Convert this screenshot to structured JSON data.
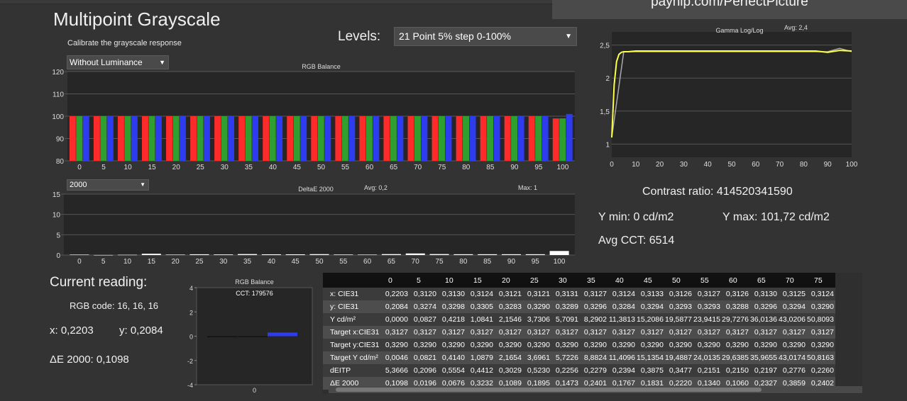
{
  "banner": "payhip.com/PerfectPicture",
  "title": "Multipoint Grayscale",
  "subtitle": "Calibrate the grayscale response",
  "luminance_mode": "Without Luminance",
  "levels": {
    "label": "Levels:",
    "value": "21 Point 5% step 0-100%"
  },
  "rgb_balance_chart": {
    "title": "RGB Balance",
    "type": "bar",
    "yticks": [
      "80",
      "90",
      "100",
      "110",
      "120"
    ],
    "ylim": [
      80,
      120
    ],
    "categories": [
      "0",
      "5",
      "10",
      "15",
      "20",
      "25",
      "30",
      "35",
      "40",
      "45",
      "50",
      "55",
      "60",
      "65",
      "70",
      "75",
      "80",
      "85",
      "90",
      "95",
      "100"
    ],
    "series": [
      {
        "color": "#ff2a2a",
        "values": [
          100,
          100,
          100,
          100,
          100,
          100,
          100,
          100,
          100,
          100,
          100,
          100,
          100,
          100,
          100,
          100,
          100,
          100,
          100,
          100,
          99
        ]
      },
      {
        "color": "#2fa02f",
        "values": [
          100,
          100,
          100,
          100,
          100,
          100,
          100,
          100,
          100,
          100,
          100,
          100,
          100,
          100,
          100,
          100,
          100,
          100,
          100,
          100,
          99
        ]
      },
      {
        "color": "#2e3cf0",
        "values": [
          100,
          100,
          100,
          100,
          100,
          100,
          100,
          100,
          100,
          100,
          100,
          100,
          100,
          100,
          100,
          100,
          100,
          100,
          100,
          100,
          101
        ]
      }
    ]
  },
  "deltae_chart": {
    "selector": "2000",
    "title": "DeltaE 2000",
    "avg_label": "Avg: 0,2",
    "max_label": "Max: 1",
    "type": "bar",
    "yticks": [
      "0",
      "5",
      "10",
      "15"
    ],
    "ylim": [
      0,
      15
    ],
    "categories": [
      "0",
      "5",
      "10",
      "15",
      "20",
      "25",
      "30",
      "35",
      "40",
      "45",
      "50",
      "55",
      "60",
      "65",
      "70",
      "75",
      "80",
      "85",
      "90",
      "95",
      "100"
    ],
    "values": [
      0.11,
      0.02,
      0.07,
      0.32,
      0.11,
      0.19,
      0.15,
      0.24,
      0.18,
      0.18,
      0.22,
      0.13,
      0.11,
      0.23,
      0.39,
      0.24,
      0.2,
      0.2,
      0.2,
      0.2,
      1.0
    ]
  },
  "gamma_chart": {
    "title": "Gamma Log/Log",
    "avg_label": "Avg: 2,4",
    "type": "line",
    "yticks": [
      "1",
      "1,5",
      "2",
      "2,5"
    ],
    "ylim": [
      0.8,
      2.7
    ],
    "xticks": [
      "0",
      "10",
      "20",
      "30",
      "40",
      "50",
      "60",
      "70",
      "80",
      "90",
      "100"
    ],
    "xlim": [
      0,
      100
    ],
    "series": [
      {
        "color": "#ffff44",
        "x": [
          0,
          1,
          2,
          3,
          4,
          5,
          7,
          10,
          15,
          20,
          30,
          40,
          50,
          60,
          70,
          80,
          85,
          90,
          95,
          100
        ],
        "y": [
          1.1,
          1.9,
          2.25,
          2.36,
          2.39,
          2.4,
          2.4,
          2.41,
          2.41,
          2.41,
          2.41,
          2.41,
          2.41,
          2.41,
          2.41,
          2.41,
          2.41,
          2.39,
          2.42,
          2.41
        ]
      },
      {
        "color": "#aaaaaa",
        "x": [
          0,
          5,
          10,
          20,
          30,
          40,
          50,
          60,
          70,
          80,
          90,
          95,
          100
        ],
        "y": [
          1.1,
          2.4,
          2.4,
          2.4,
          2.4,
          2.4,
          2.4,
          2.4,
          2.4,
          2.4,
          2.4,
          2.45,
          2.4
        ]
      }
    ]
  },
  "stats": {
    "contrast": "Contrast ratio: 414520341590",
    "ymin": "Y min: 0 cd/m2",
    "ymax": "Y max: 101,72 cd/m2",
    "avg_cct": "Avg CCT: 6514"
  },
  "current": {
    "heading": "Current reading:",
    "rgb_code": "RGB code: 16, 16, 16",
    "x": "x: 0,2203",
    "y": "y: 0,2084",
    "de": "ΔE 2000: 0,1098"
  },
  "mini_chart": {
    "title": "RGB Balance",
    "cct": "CCT: 179576",
    "type": "bar",
    "yticks": [
      "-4",
      "-2",
      "0",
      "2",
      "4"
    ],
    "ylim": [
      -4,
      4
    ],
    "xlabel": "0",
    "values": {
      "red": 0,
      "green": 0,
      "blue": 0.3
    }
  },
  "table": {
    "columns": [
      "0",
      "5",
      "10",
      "15",
      "20",
      "25",
      "30",
      "35",
      "40",
      "45",
      "50",
      "55",
      "60",
      "65",
      "70",
      "75"
    ],
    "rows": [
      {
        "label": "x: CIE31",
        "values": [
          "0,2203",
          "0,3120",
          "0,3130",
          "0,3124",
          "0,3121",
          "0,3121",
          "0,3131",
          "0,3127",
          "0,3124",
          "0,3133",
          "0,3126",
          "0,3127",
          "0,3126",
          "0,3130",
          "0,3125",
          "0,3124"
        ]
      },
      {
        "label": "y: CIE31",
        "values": [
          "0,2084",
          "0,3274",
          "0,3298",
          "0,3305",
          "0,3283",
          "0,3290",
          "0,3289",
          "0,3296",
          "0,3284",
          "0,3294",
          "0,3293",
          "0,3293",
          "0,3288",
          "0,3296",
          "0,3294",
          "0,3290"
        ]
      },
      {
        "label": "Y cd/m²",
        "values": [
          "0,0000",
          "0,0827",
          "0,4218",
          "1,0841",
          "2,1546",
          "3,7306",
          "5,7091",
          "8,2902",
          "11,3813",
          "15,2086",
          "19,5877",
          "23,9415",
          "29,7276",
          "36,0136",
          "43,0206",
          "50,8093"
        ]
      },
      {
        "label": "Target x:CIE31",
        "values": [
          "0,3127",
          "0,3127",
          "0,3127",
          "0,3127",
          "0,3127",
          "0,3127",
          "0,3127",
          "0,3127",
          "0,3127",
          "0,3127",
          "0,3127",
          "0,3127",
          "0,3127",
          "0,3127",
          "0,3127",
          "0,3127"
        ]
      },
      {
        "label": "Target y:CIE31",
        "values": [
          "0,3290",
          "0,3290",
          "0,3290",
          "0,3290",
          "0,3290",
          "0,3290",
          "0,3290",
          "0,3290",
          "0,3290",
          "0,3290",
          "0,3290",
          "0,3290",
          "0,3290",
          "0,3290",
          "0,3290",
          "0,3290"
        ]
      },
      {
        "label": "Target Y cd/m²",
        "values": [
          "0,0046",
          "0,0821",
          "0,4140",
          "1,0879",
          "2,1654",
          "3,6961",
          "5,7226",
          "8,8824",
          "11,4096",
          "15,1354",
          "19,4887",
          "24,0135",
          "29,6385",
          "35,9655",
          "43,0174",
          "50,8163"
        ]
      },
      {
        "label": "dEITP",
        "values": [
          "5,3666",
          "0,2096",
          "0,5554",
          "0,4412",
          "0,3029",
          "0,5230",
          "0,2256",
          "0,2279",
          "0,2394",
          "0,3875",
          "0,3477",
          "0,2151",
          "0,2150",
          "0,2197",
          "0,2776",
          "0,2260"
        ]
      },
      {
        "label": "ΔE 2000",
        "values": [
          "0,1098",
          "0,0196",
          "0,0676",
          "0,3232",
          "0,1089",
          "0,1895",
          "0,1473",
          "0,2401",
          "0,1767",
          "0,1831",
          "0,2220",
          "0,1340",
          "0,1060",
          "0,2327",
          "0,3859",
          "0,2402"
        ]
      }
    ]
  }
}
